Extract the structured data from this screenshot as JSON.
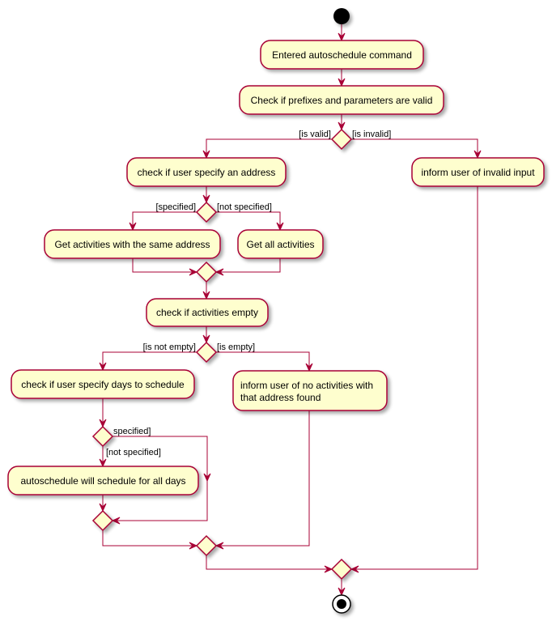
{
  "diagram": {
    "type": "UML activity diagram",
    "colors": {
      "node_fill": "#FEFECE",
      "border": "#A80036",
      "start_end": "#000000",
      "background": "#FFFFFF"
    },
    "nodes": {
      "start": {
        "kind": "start"
      },
      "a1": {
        "kind": "activity",
        "label": "Entered autoschedule command"
      },
      "a2": {
        "kind": "activity",
        "label": "Check if prefixes and parameters are valid"
      },
      "d1": {
        "kind": "decision"
      },
      "a3": {
        "kind": "activity",
        "label": "check if user specify an address"
      },
      "a4": {
        "kind": "activity",
        "label": "inform user of invalid input"
      },
      "d2": {
        "kind": "decision"
      },
      "a5": {
        "kind": "activity",
        "label": "Get activities with the same address"
      },
      "a6": {
        "kind": "activity",
        "label": "Get all activities"
      },
      "m1": {
        "kind": "merge"
      },
      "a7": {
        "kind": "activity",
        "label": "check if activities empty"
      },
      "d3": {
        "kind": "decision"
      },
      "a8": {
        "kind": "activity",
        "label": "check if user specify days to schedule"
      },
      "a9": {
        "kind": "activity",
        "label_lines": [
          "inform user of no activities with",
          "that address found"
        ]
      },
      "d4": {
        "kind": "decision"
      },
      "a10": {
        "kind": "activity",
        "label": "autoschedule will schedule for all days"
      },
      "m2": {
        "kind": "merge"
      },
      "m3": {
        "kind": "merge"
      },
      "m4": {
        "kind": "merge"
      },
      "end": {
        "kind": "end"
      }
    },
    "guards": {
      "d1_left": "[is valid]",
      "d1_right": "[is invalid]",
      "d2_left": "[specified]",
      "d2_right": "[not specified]",
      "d3_left": "[is not empty]",
      "d3_right": "[is empty]",
      "d4_right": "specified]",
      "d4_down": "[not specified]"
    },
    "edges": [
      [
        "start",
        "a1"
      ],
      [
        "a1",
        "a2"
      ],
      [
        "a2",
        "d1"
      ],
      [
        "d1",
        "a3",
        "[is valid]"
      ],
      [
        "d1",
        "a4",
        "[is invalid]"
      ],
      [
        "a3",
        "d2"
      ],
      [
        "d2",
        "a5",
        "[specified]"
      ],
      [
        "d2",
        "a6",
        "[not specified]"
      ],
      [
        "a5",
        "m1"
      ],
      [
        "a6",
        "m1"
      ],
      [
        "m1",
        "a7"
      ],
      [
        "a7",
        "d3"
      ],
      [
        "d3",
        "a8",
        "[is not empty]"
      ],
      [
        "d3",
        "a9",
        "[is empty]"
      ],
      [
        "a8",
        "d4"
      ],
      [
        "d4",
        "a10",
        "[not specified]"
      ],
      [
        "d4",
        "m2",
        "specified]"
      ],
      [
        "a10",
        "m2"
      ],
      [
        "m2",
        "m3"
      ],
      [
        "a9",
        "m3"
      ],
      [
        "m3",
        "m4"
      ],
      [
        "a4",
        "m4"
      ],
      [
        "m4",
        "end"
      ]
    ]
  }
}
